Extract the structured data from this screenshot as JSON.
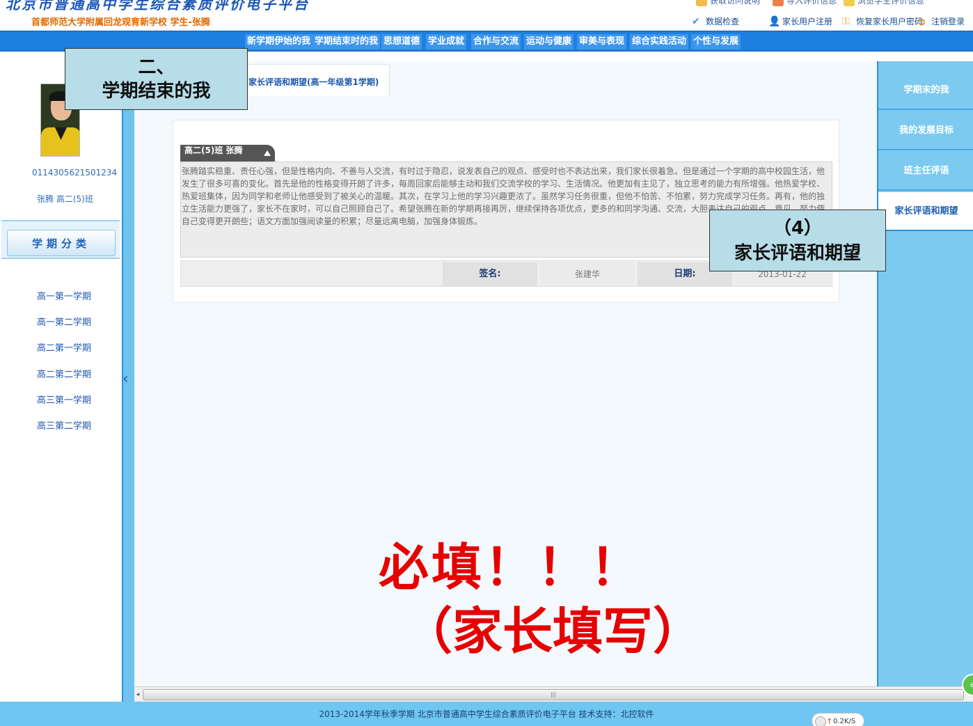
{
  "header": {
    "site_title": "北京市普通高中学生综合素质评价电子平台",
    "subtitle": "首都师范大学附属回龙观育新学校 学生-张腾",
    "top_links_cut": [
      "获取访问说明",
      "导入评价信息",
      "浏览学生评价信息"
    ],
    "top_links": [
      {
        "label": "数据检查",
        "icon": "checkmark-icon"
      },
      {
        "label": "家长用户注册",
        "icon": "user-add-icon"
      },
      {
        "label": "恢复家长用户密码",
        "icon": "key-icon"
      },
      {
        "label": "注销登录",
        "icon": "logout-icon"
      }
    ]
  },
  "nav": {
    "tabs": [
      "新学期伊始的我",
      "学期结束时的我",
      "思想道德",
      "学业成就",
      "合作与交流",
      "运动与健康",
      "审美与表现",
      "综合实践活动",
      "个性与发展"
    ]
  },
  "student": {
    "id": "011430562150123​4",
    "name_class": "张腾 高二(5)班"
  },
  "semesters": {
    "header": "学期分类",
    "items": [
      "高一第一学期",
      "高一第二学期",
      "高二第一学期",
      "高二第二学期",
      "高三第一学期",
      "高三第二学期"
    ]
  },
  "main": {
    "tab_title": "家长评语和期望(高一年级第1学期)",
    "card_tab": "高二(5)班 张腾",
    "comment": "张腾踏实稳重、责任心强，但是性格内向、不善与人交流，有时过于隐忍，说发表自己的观点、感受时也不表达出来，我们家长很着急。但是通过一个学期的高中校园生活，他发生了很多可喜的变化。首先是他的性格变得开朗了许多，每周回家后能够主动和我们交流学校的学习、生活情况。他更加有主见了，独立思考的能力有所增强。他热爱学校、热爱班集体，因为同学和老师让他感受到了被关心的温暖。其次，在学习上他的学习兴趣更浓了。虽然学习任务很重，但他不怕苦、不怕累，努力完成学习任务。再有，他的独立生活能力更强了，家长不在家时，可以自己照顾自己了。希望张腾在新的学期再接再厉，继续保持各项优点，更多的和同学沟通、交流，大胆表达自己的观点、意见，努力使自己变得更开朗些；语文方面加强阅读量的积累；尽量远离电脑，加强身体锻炼。",
    "signature_label": "签名:",
    "signature_value": "张建华",
    "date_label": "日期:",
    "date_value": "2013-01-22"
  },
  "right_menu": {
    "items": [
      "学期末的我",
      "我的发展目标",
      "班主任评语",
      "家长评语和期望"
    ],
    "active_index": 3
  },
  "overlays": {
    "section_number": "二、",
    "section_title": "学期结束的我",
    "item_number": "（4）",
    "item_title": "家长评语和期望",
    "must_fill": "必填！！！",
    "parent_fill": "（家长填写）"
  },
  "footer": {
    "text": "2013-2014学年秋季学期 北京市普通高中学生综合素质评价电子平台 技术支持：北控软件",
    "speed": "0.2K/S",
    "widget_value": "60"
  },
  "colors": {
    "nav_blue": "#1d7fe0",
    "sidebar_blue": "#7ccaf0",
    "overlay_fill": "#b7dde8",
    "emphasis_red": "#e60000"
  }
}
